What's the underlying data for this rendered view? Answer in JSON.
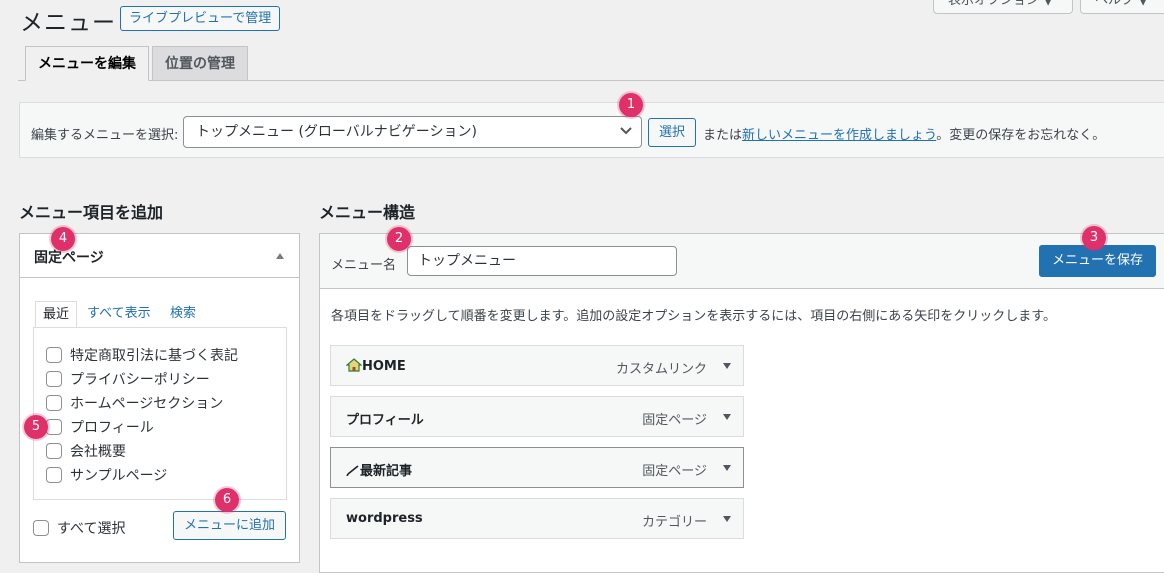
{
  "header": {
    "title": "メニュー",
    "live_preview_label": "ライブプレビューで管理",
    "screen_options_label": "表示オプション ▼",
    "help_label": "ヘルプ ▼"
  },
  "tabs": [
    {
      "label": "メニューを編集",
      "active": true
    },
    {
      "label": "位置の管理",
      "active": false
    }
  ],
  "manage_bar": {
    "label": "編集するメニューを選択:",
    "selected_menu": "トップメニュー (グローバルナビゲーション)",
    "select_button": "選択",
    "or_text": "または",
    "create_link": "新しいメニューを作成しましょう",
    "suffix_text": "。変更の保存をお忘れなく。"
  },
  "add_items": {
    "heading": "メニュー項目を追加",
    "panel_title": "固定ページ",
    "subtabs": [
      "最近",
      "すべて表示",
      "検索"
    ],
    "pages": [
      "特定商取引法に基づく表記",
      "プライバシーポリシー",
      "ホームページセクション",
      "プロフィール",
      "会社概要",
      "サンプルページ"
    ],
    "select_all_label": "すべて選択",
    "add_button": "メニューに追加"
  },
  "structure": {
    "heading": "メニュー構造",
    "menu_name_label": "メニュー名",
    "menu_name_value": "トップメニュー",
    "save_button": "メニューを保存",
    "instructions": "各項目をドラッグして順番を変更します。追加の設定オプションを表示するには、項目の右側にある矢印をクリックします。",
    "items": [
      {
        "title": "HOME",
        "type": "カスタムリンク",
        "icon": "house-icon"
      },
      {
        "title": "プロフィール",
        "type": "固定ページ",
        "icon": ""
      },
      {
        "title": "最新記事",
        "type": "固定ページ",
        "icon": "pencil-icon"
      },
      {
        "title": "wordpress",
        "type": "カテゴリー",
        "icon": ""
      }
    ]
  },
  "badges": [
    "1",
    "2",
    "3",
    "4",
    "5",
    "6"
  ],
  "colors": {
    "accent": "#2271b1",
    "badge": "#e0306a",
    "background": "#f0f0f1"
  }
}
